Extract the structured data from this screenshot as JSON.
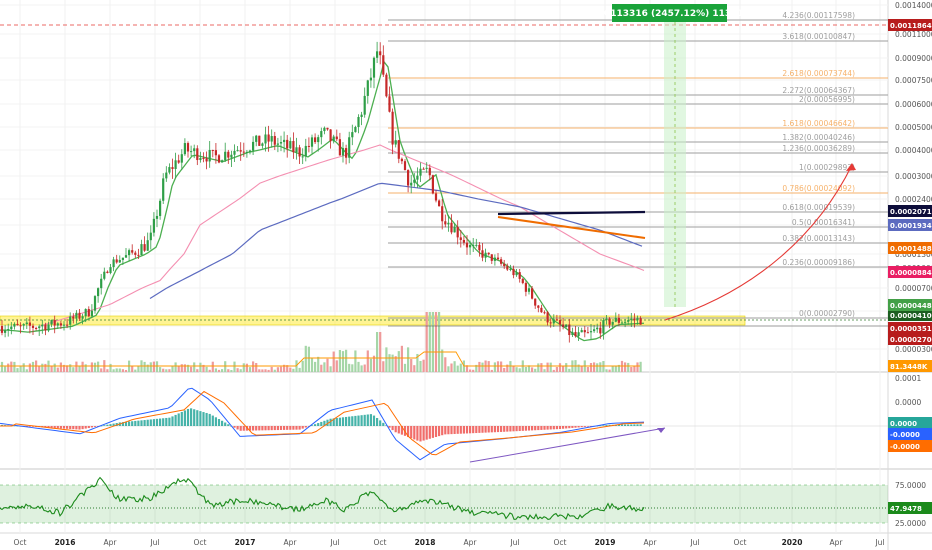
{
  "chart_data": {
    "type": "candlestick",
    "title": "",
    "x_axis": {
      "tick_labels": [
        "Oct",
        "2016",
        "Apr",
        "Jul",
        "Oct",
        "2017",
        "Apr",
        "Jul",
        "Oct",
        "2018",
        "Apr",
        "Jul",
        "Oct",
        "2019",
        "Apr",
        "Jul",
        "Oct",
        "2020",
        "Apr",
        "Jul"
      ]
    },
    "price_axis": {
      "scale": "log",
      "tick_labels": [
        "0.00140000",
        "0.00110000",
        "0.00090000",
        "0.00075000",
        "0.00060000",
        "0.00050000",
        "0.00040000",
        "0.00030000",
        "0.00024000",
        "0.00018000",
        "0.00013000",
        "0.00010000",
        "0.00007000",
        "0.00005000",
        "0.00004000",
        "0.00003000"
      ]
    },
    "price_markers": [
      {
        "label": "0.00118640",
        "color": "#b71c1c"
      },
      {
        "label": "0.00020711",
        "color": "#0d0d3a"
      },
      {
        "label": "0.00019347",
        "color": "#5c6bc0"
      },
      {
        "label": "0.00014886",
        "color": "#ef6c00"
      },
      {
        "label": "0.00008846",
        "color": "#e91e63"
      },
      {
        "label": "0.00004102",
        "color": "#1b5e20"
      },
      {
        "label": "0.00003513",
        "color": "#b71c1c"
      },
      {
        "label": "0.00002702",
        "color": "#b71c1c"
      },
      {
        "label": "0.00004483",
        "color": "#43a047"
      }
    ],
    "fib_levels": [
      {
        "label": "4.236(0.00117598)",
        "color": "#9e9e9e"
      },
      {
        "label": "3.618(0.00100847)",
        "color": "#9e9e9e"
      },
      {
        "label": "2.618(0.00073744)",
        "color": "#f6b26b"
      },
      {
        "label": "2.272(0.00064367)",
        "color": "#9e9e9e"
      },
      {
        "label": "2(0.00056995)",
        "color": "#9e9e9e"
      },
      {
        "label": "1.618(0.00046642)",
        "color": "#f6b26b"
      },
      {
        "label": "1.382(0.00040246)",
        "color": "#9e9e9e"
      },
      {
        "label": "1.236(0.00036289)",
        "color": "#9e9e9e"
      },
      {
        "label": "1(0.00029893)",
        "color": "#9e9e9e"
      },
      {
        "label": "0.786(0.00024092)",
        "color": "#f6b26b"
      },
      {
        "label": "0.618(0.00019539)",
        "color": "#9e9e9e"
      },
      {
        "label": "0.5(0.00016341)",
        "color": "#9e9e9e"
      },
      {
        "label": "0.382(0.00013143)",
        "color": "#9e9e9e"
      },
      {
        "label": "0.236(0.00009186)",
        "color": "#9e9e9e"
      },
      {
        "label": "0(0.00002790)",
        "color": "#9e9e9e"
      }
    ],
    "projection_label": "0.00113316 (2457.12%) 113316",
    "volume_axis_label": "81.3448K",
    "macd": {
      "axis_labels": [
        "0.0001",
        "0.0000",
        "-0.0001"
      ],
      "markers": [
        {
          "label": "0.0000",
          "color": "#26a69a"
        },
        {
          "label": "-0.0000",
          "color": "#2962ff"
        },
        {
          "label": "-0.0000",
          "color": "#ff6d00"
        }
      ]
    },
    "rsi": {
      "value": 47.9478,
      "axis_labels": [
        "75.0000",
        "25.0000"
      ],
      "marker_label": "47.9478"
    }
  },
  "colors": {
    "up": "#2e9e47",
    "down": "#c62828",
    "ema_fast": "#4caf50",
    "ema_slow": "#5c6bc0",
    "ma_pink": "#f48fb1",
    "projection": "#e53935",
    "support_zone": "#ffeb3b"
  }
}
